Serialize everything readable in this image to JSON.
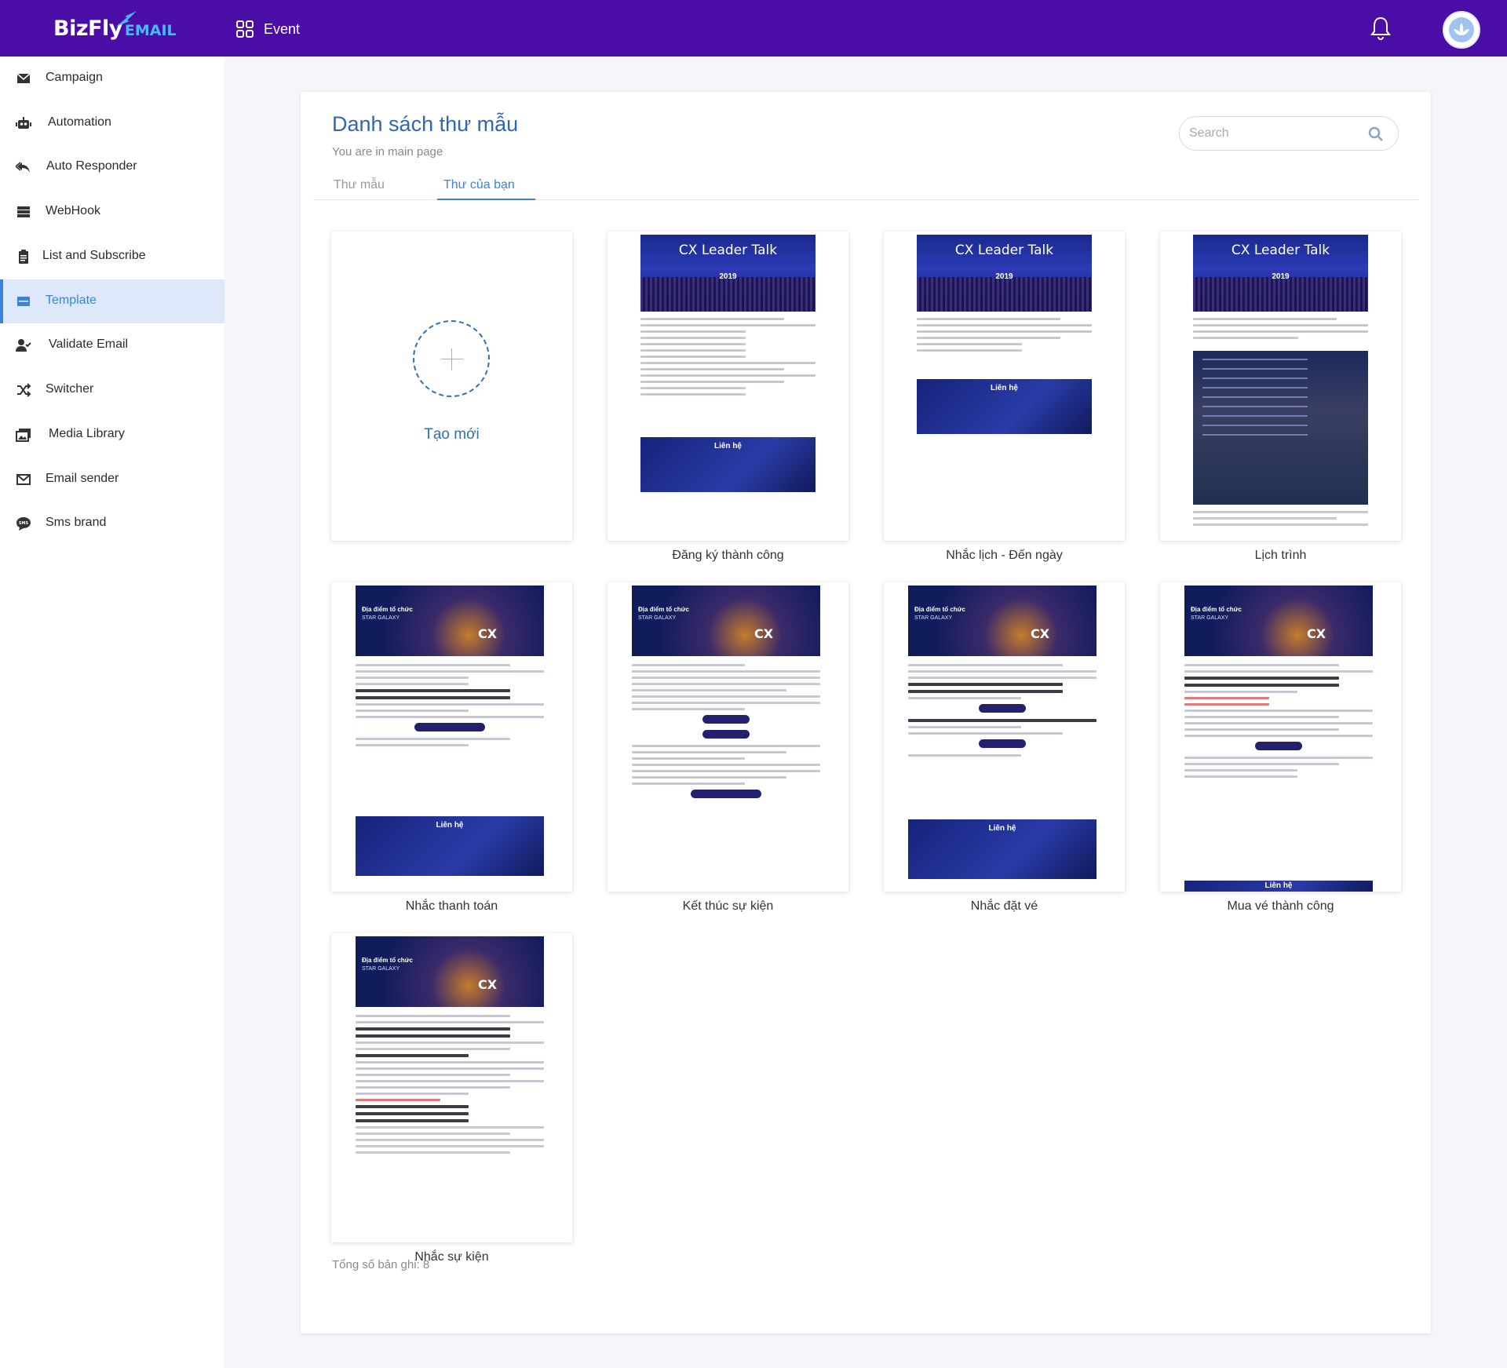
{
  "header": {
    "logo_main": "BizFly",
    "logo_sub": "EMAIL",
    "event_label": "Event",
    "icons": [
      "grid-icon",
      "bell-icon",
      "avatar-icon"
    ],
    "color": "#4a0ea6"
  },
  "sidebar": {
    "active_color": "#3d82d8",
    "items": [
      {
        "label": "Campaign",
        "icon": "envelope-icon"
      },
      {
        "label": "Automation",
        "icon": "robot-icon"
      },
      {
        "label": "Auto Responder",
        "icon": "reply-all-icon"
      },
      {
        "label": "WebHook",
        "icon": "server-icon"
      },
      {
        "label": "List and Subscribe",
        "icon": "clipboard-icon"
      },
      {
        "label": "Template",
        "icon": "template-icon",
        "active": true
      },
      {
        "label": "Validate Email",
        "icon": "user-check-icon"
      },
      {
        "label": "Switcher",
        "icon": "shuffle-icon"
      },
      {
        "label": "Media Library",
        "icon": "images-icon"
      },
      {
        "label": "Email sender",
        "icon": "envelope-outline-icon"
      },
      {
        "label": "Sms brand",
        "icon": "sms-icon"
      }
    ]
  },
  "main": {
    "title": "Danh sách thư mẫu",
    "subtitle": "You are in main page",
    "search_placeholder": "Search",
    "tabs": [
      {
        "label": "Thư mẫu",
        "active": false
      },
      {
        "label": "Thư của bạn",
        "active": true
      }
    ],
    "create_label": "Tạo mới",
    "templates": [
      {
        "name": "Đăng ký thành công",
        "banner": "CX Leader Talk",
        "year": "2019",
        "footer": "Liên hệ"
      },
      {
        "name": "Nhắc lịch - Đến ngày",
        "banner": "CX Leader Talk",
        "year": "2019",
        "footer": "Liên hệ"
      },
      {
        "name": "Lịch trình",
        "banner": "CX Leader Talk",
        "year": "2019"
      },
      {
        "name": "Nhắc thanh toán",
        "banner": "Địa điểm tổ chức",
        "venue": "STAR GALAXY",
        "brand": "CX",
        "footer": "Liên hệ"
      },
      {
        "name": "Kết thúc sự kiện",
        "banner": "Địa điểm tổ chức",
        "venue": "STAR GALAXY",
        "brand": "CX"
      },
      {
        "name": "Nhắc đặt vé",
        "banner": "Địa điểm tổ chức",
        "venue": "STAR GALAXY",
        "brand": "CX",
        "footer": "Liên hệ"
      },
      {
        "name": "Mua vé thành công",
        "banner": "Địa điểm tổ chức",
        "venue": "STAR GALAXY",
        "brand": "CX",
        "footer": "Liên hệ"
      },
      {
        "name": "Nhắc sự kiện",
        "banner": "Địa điểm tổ chức",
        "venue": "STAR GALAXY",
        "brand": "CX"
      }
    ],
    "total_label": "Tổng số bản ghi: 8"
  }
}
